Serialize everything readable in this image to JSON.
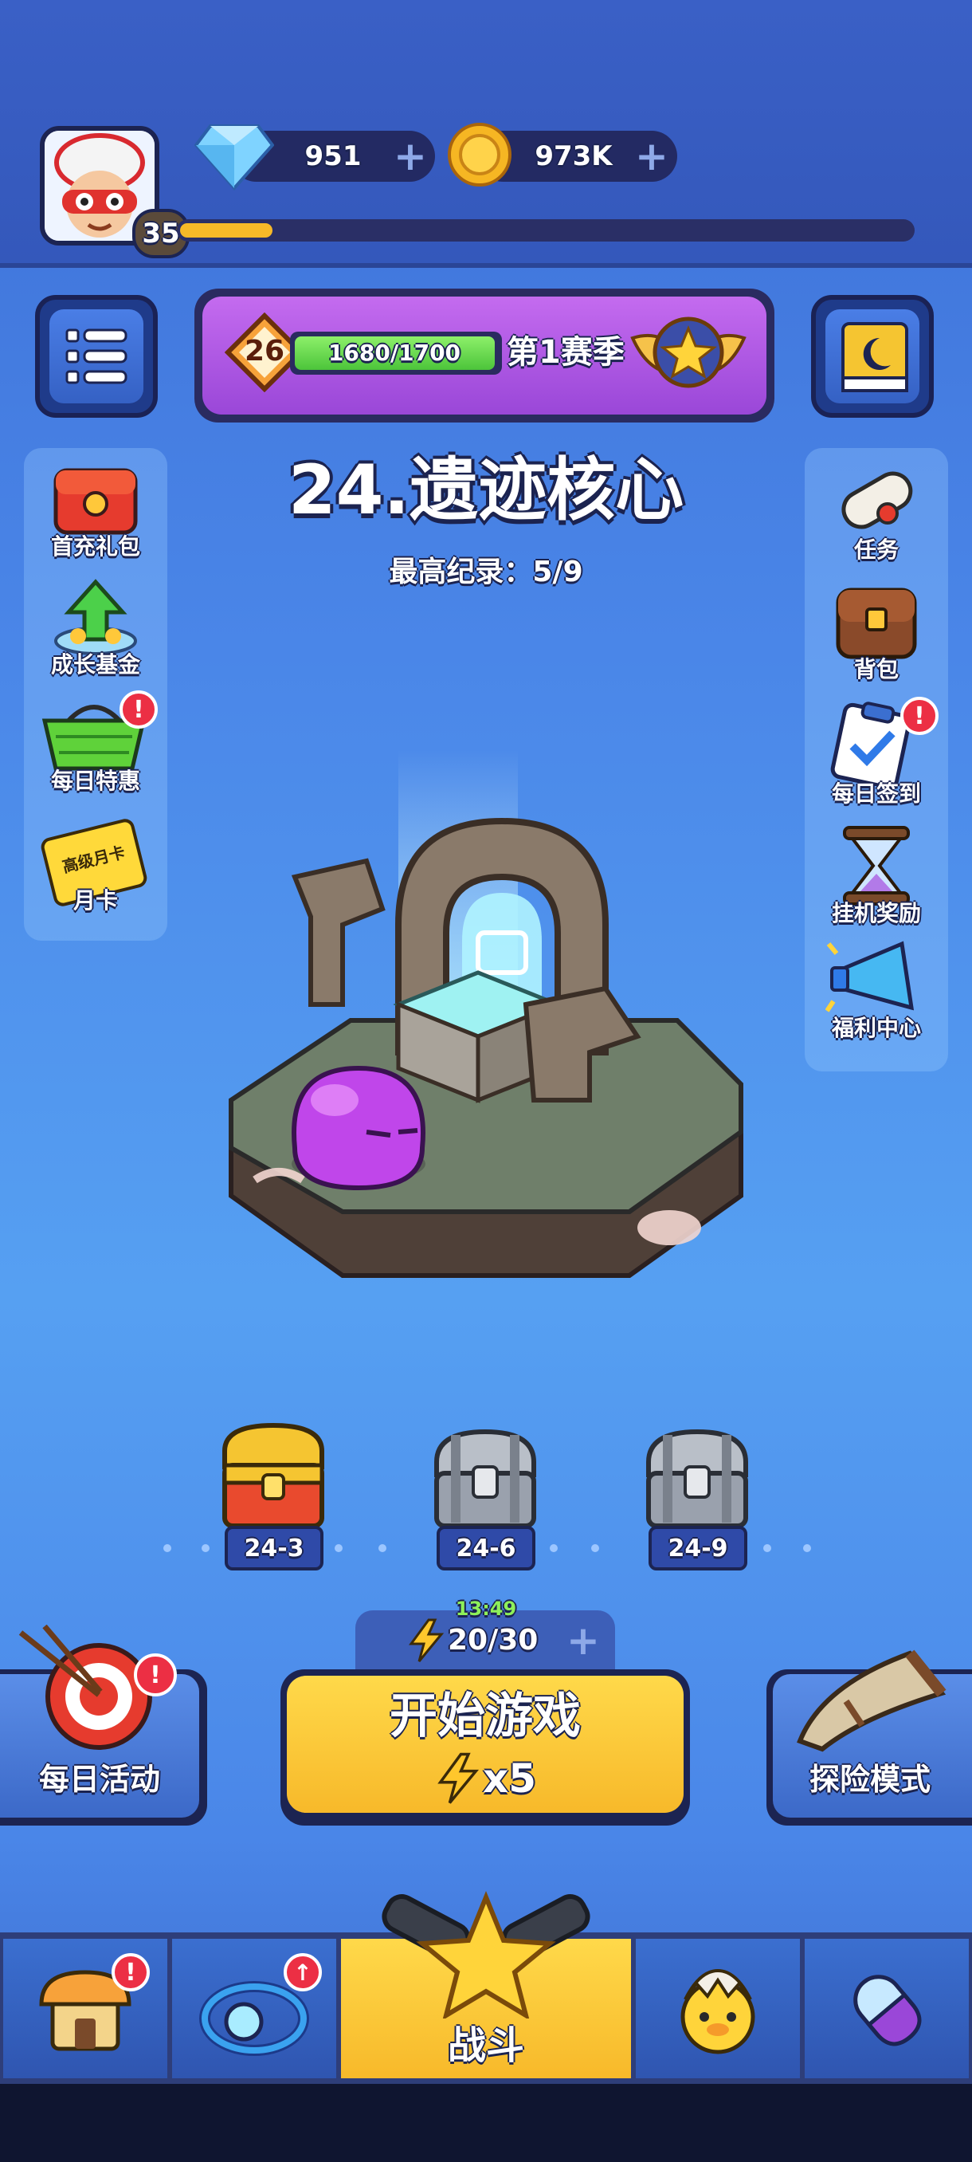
{
  "player": {
    "level": "35"
  },
  "currency": {
    "gems": "951",
    "coins": "973K"
  },
  "season": {
    "rank": "26",
    "progress_text": "1680/1700",
    "progress": 0.988,
    "label": "第1赛季"
  },
  "stage": {
    "title": "24.遗迹核心",
    "record": "最高纪录：5/9"
  },
  "left_menu": [
    {
      "label": "首充礼包"
    },
    {
      "label": "成长基金"
    },
    {
      "label": "每日特惠"
    },
    {
      "label": "月卡",
      "card_text": "高级月卡"
    }
  ],
  "right_menu": [
    {
      "label": "任务"
    },
    {
      "label": "背包"
    },
    {
      "label": "每日签到"
    },
    {
      "label": "挂机奖励"
    },
    {
      "label": "福利中心"
    }
  ],
  "chests": [
    {
      "label": "24-3"
    },
    {
      "label": "24-6"
    },
    {
      "label": "24-9"
    }
  ],
  "energy": {
    "timer": "13:49",
    "value": "20/30"
  },
  "start_button": {
    "label": "开始游戏",
    "cost": "x5"
  },
  "daily_activity": {
    "label": "每日活动"
  },
  "adventure": {
    "label": "探险模式"
  },
  "nav": {
    "battle_label": "战斗"
  },
  "colors": {
    "accent_yellow": "#f7c62c",
    "panel_blue": "#4a86e8",
    "badge_red": "#ec2f44",
    "season_purple": "#b25de6"
  }
}
